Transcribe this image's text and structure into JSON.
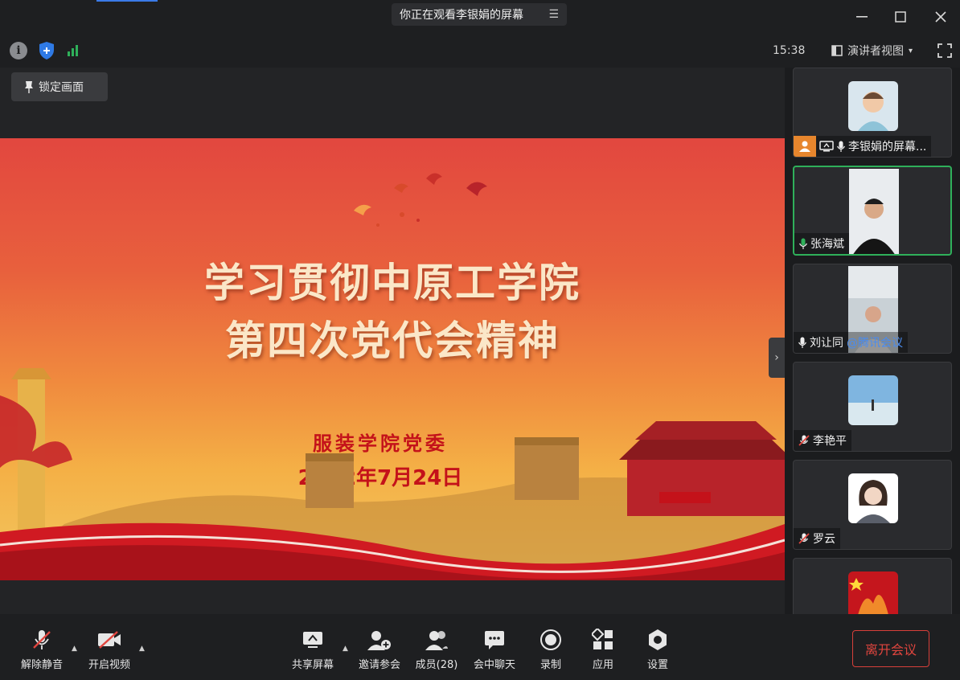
{
  "window": {
    "title": "你正在观看李银娟的屏幕",
    "menu_icon": "list-icon",
    "minimize_icon": "minimize-icon",
    "maximize_icon": "maximize-icon",
    "close_icon": "close-icon"
  },
  "infobar": {
    "time": "15:38",
    "view_mode": "演讲者视图",
    "view_caret": "▾"
  },
  "stage": {
    "lock_label": "锁定画面",
    "slide": {
      "title_line1": "学习贯彻中原工学院",
      "title_line2": "第四次党代会精神",
      "org": "服装学院党委",
      "date": "2022年7月24日"
    }
  },
  "participants": [
    {
      "name": "李银娟的屏幕...",
      "role": "host",
      "sharing": true,
      "mic": "on"
    },
    {
      "name": "张海斌",
      "speaking": true,
      "mic": "on"
    },
    {
      "name": "刘让同",
      "mic": "on",
      "overlay": "@腾讯会议"
    },
    {
      "name": "李艳平",
      "mic": "muted"
    },
    {
      "name": "罗云",
      "mic": "muted"
    },
    {
      "name": "",
      "mic": "unknown"
    }
  ],
  "toolbar": {
    "unmute": "解除静音",
    "start_video": "开启视频",
    "share_screen": "共享屏幕",
    "invite": "邀请参会",
    "members": "成员(28)",
    "chat": "会中聊天",
    "record": "录制",
    "apps": "应用",
    "settings": "设置",
    "leave": "离开会议"
  },
  "colors": {
    "speaking_border": "#2fb05a",
    "host_badge": "#e7862d",
    "leave": "#e0453e",
    "slide_red": "#c4121a"
  }
}
